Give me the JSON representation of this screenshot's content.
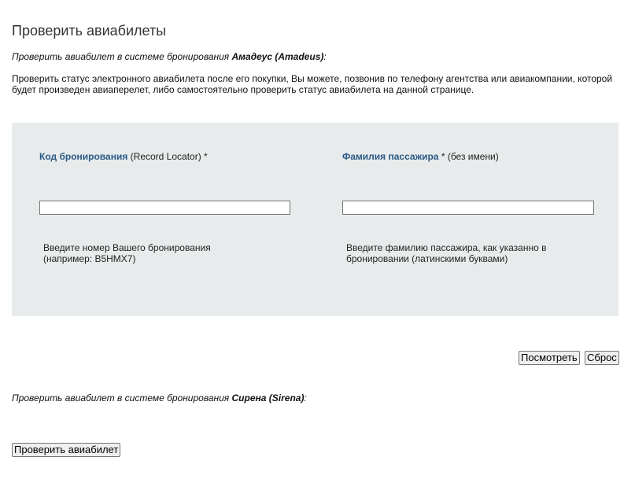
{
  "page": {
    "title": "Проверить авиабилеты"
  },
  "amadeus": {
    "heading_prefix": "Проверить авиабилет в системе бронирования ",
    "heading_system": "Амадеус (Amadeus)",
    "heading_suffix": ":",
    "intro": "Проверить статус электронного авиабилета после его покупки, Вы можете, позвонив по телефону агентства или авиакомпании, которой будет произведен авиаперелет, либо самостоятельно проверить статус авиабилета на данной странице."
  },
  "form": {
    "booking_code": {
      "label_strong": "Код бронирования",
      "label_rest": " (Record Locator) *",
      "value": "",
      "hint_line1": "Введите номер Вашего бронирования",
      "hint_line2": "(например: B5HMX7)"
    },
    "surname": {
      "label_strong": "Фамилия пассажира",
      "label_rest": " * (без имени)",
      "value": "",
      "hint_line1": "Введите фамилию пассажира, как указанно в",
      "hint_line2": "бронировании (латинскими буквами)"
    },
    "view_button": "Посмотреть",
    "reset_button": "Сброс"
  },
  "sirena": {
    "heading_prefix": "Проверить авиабилет в системе бронирования ",
    "heading_system": "Сирена (Sirena)",
    "heading_suffix": ":",
    "check_button": "Проверить авиабилет"
  },
  "colors": {
    "panel_background": "#e8ebec",
    "label_accent": "#2a5a86"
  }
}
